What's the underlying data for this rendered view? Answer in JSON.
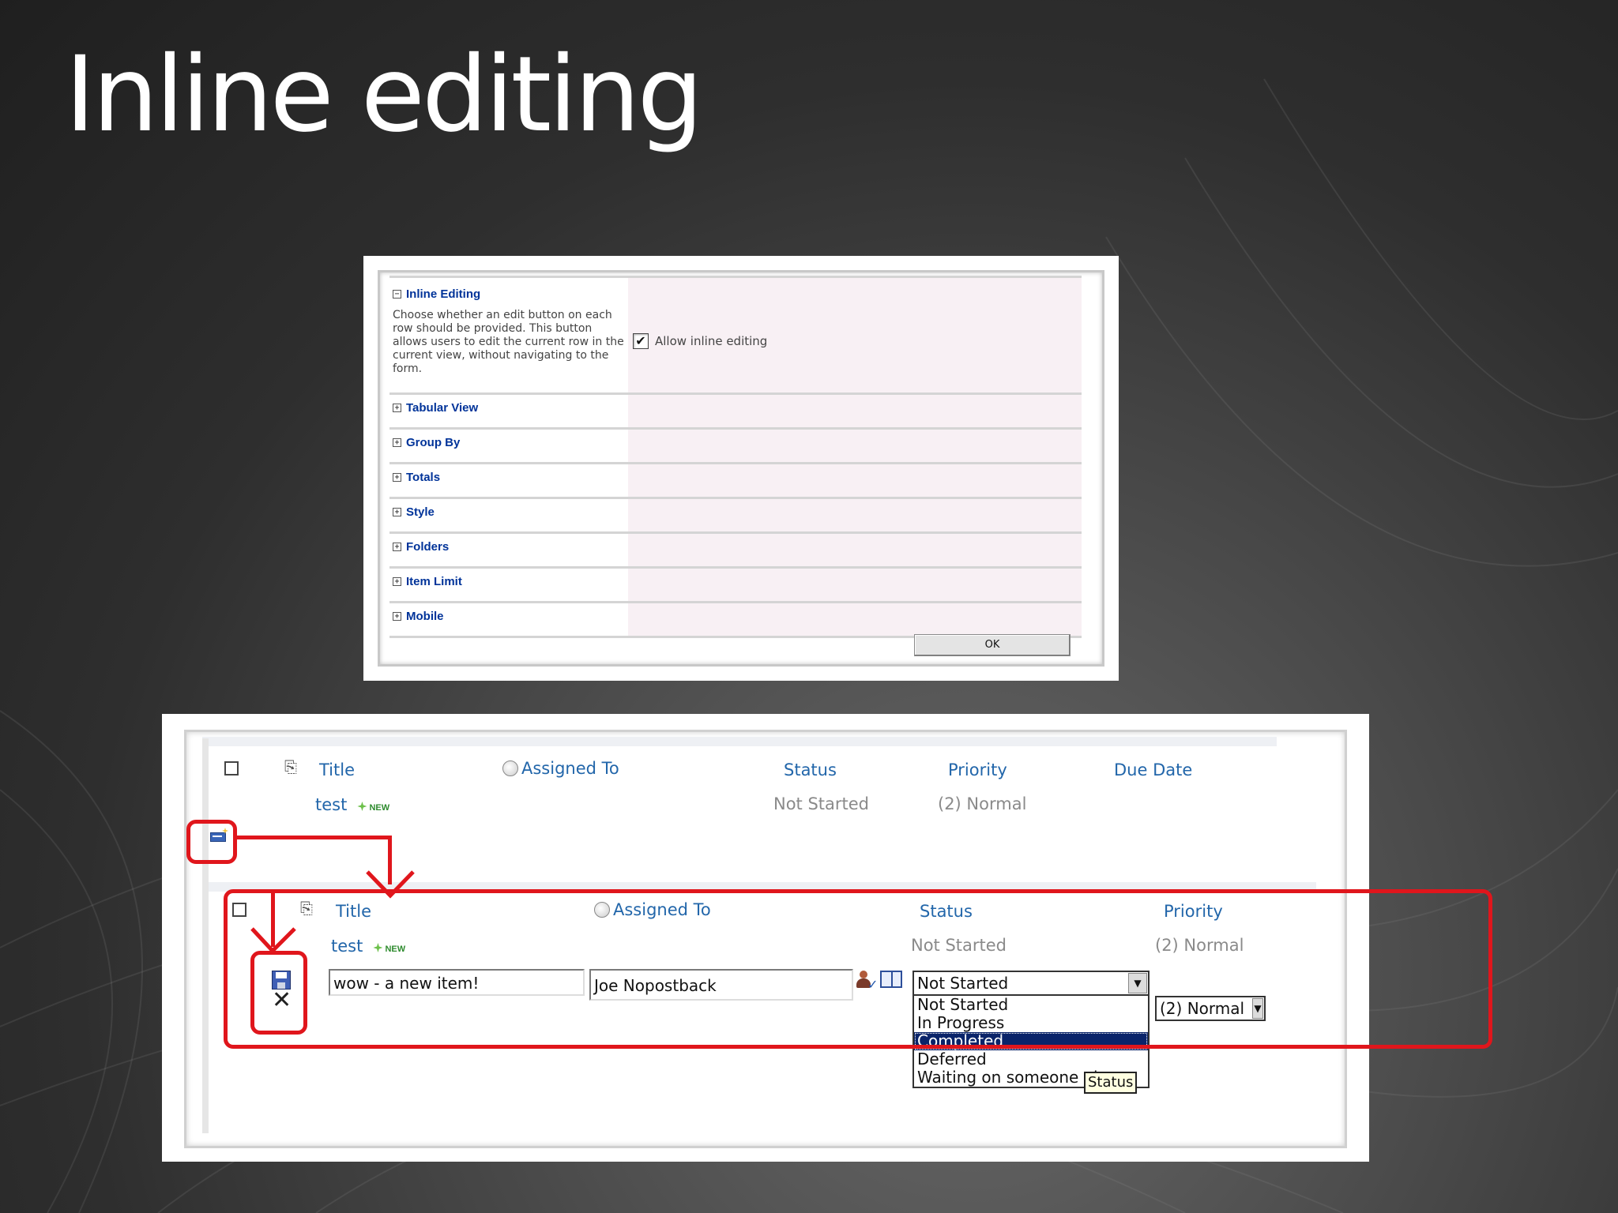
{
  "slide": {
    "title": "Inline editing"
  },
  "settings": {
    "inline_section": {
      "title": "Inline Editing",
      "description": "Choose whether an edit button on each row should be provided. This button allows users to edit the current row in the current view, without navigating to the form.",
      "checkbox_label": "Allow inline editing",
      "checked": true
    },
    "sections": [
      "Tabular View",
      "Group By",
      "Totals",
      "Style",
      "Folders",
      "Item Limit",
      "Mobile"
    ],
    "ok_label": "OK"
  },
  "list_view": {
    "columns": {
      "title": "Title",
      "assigned_to": "Assigned To",
      "status": "Status",
      "priority": "Priority",
      "due_date": "Due Date"
    },
    "row": {
      "title": "test",
      "badge": "NEW",
      "status": "Not Started",
      "priority": "(2) Normal"
    }
  },
  "edit_view": {
    "columns": {
      "title": "Title",
      "assigned_to": "Assigned To",
      "status": "Status",
      "priority": "Priority"
    },
    "row": {
      "title": "test",
      "badge": "NEW",
      "status": "Not Started",
      "priority": "(2) Normal"
    },
    "editor": {
      "title_value": "wow - a new item!",
      "assigned_value": "Joe Nopostback",
      "status_selected": "Not Started",
      "priority_selected": "(2) Normal",
      "status_options": [
        "Not Started",
        "In Progress",
        "Completed",
        "Deferred",
        "Waiting on someone else"
      ],
      "highlighted_option": "Completed",
      "tooltip": "Status"
    }
  },
  "colors": {
    "accent_red": "#e0161c",
    "link_blue": "#2266aa",
    "highlight_navy": "#0a246a"
  }
}
